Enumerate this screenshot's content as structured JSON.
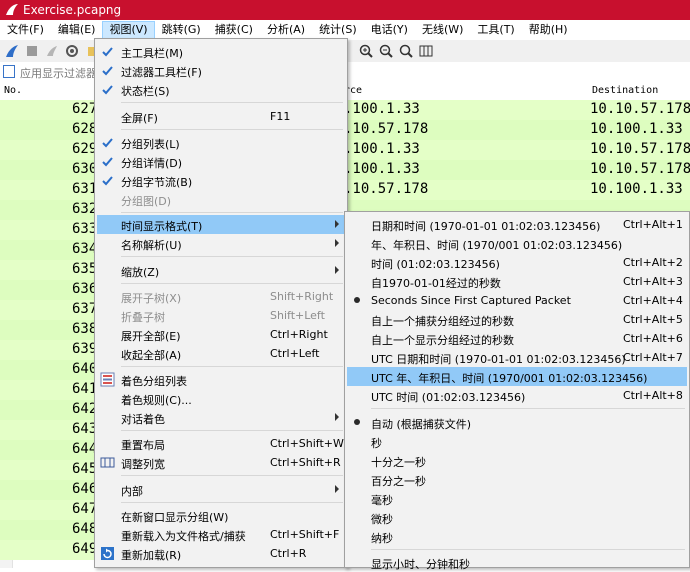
{
  "window": {
    "title": "Exercise.pcapng"
  },
  "menubar": [
    "文件(F)",
    "编辑(E)",
    "视图(V)",
    "跳转(G)",
    "捕获(C)",
    "分析(A)",
    "统计(S)",
    "电话(Y)",
    "无线(W)",
    "工具(T)",
    "帮助(H)"
  ],
  "filter": {
    "placeholder": "应用显示过滤器"
  },
  "columns": {
    "no": "No.",
    "source": "rce",
    "destination": "Destination"
  },
  "packets": [
    {
      "no": "627",
      "src": ".100.1.33",
      "dst": "10.10.57.178"
    },
    {
      "no": "628",
      "src": ".10.57.178",
      "dst": "10.100.1.33"
    },
    {
      "no": "629",
      "src": ".100.1.33",
      "dst": "10.10.57.178"
    },
    {
      "no": "630",
      "src": ".100.1.33",
      "dst": "10.10.57.178"
    },
    {
      "no": "631",
      "src": ".10.57.178",
      "dst": "10.100.1.33"
    },
    {
      "no": "632",
      "src": "",
      "dst": ""
    },
    {
      "no": "633",
      "src": "",
      "dst": ""
    },
    {
      "no": "634",
      "src": "",
      "dst": ""
    },
    {
      "no": "635",
      "src": "",
      "dst": ""
    },
    {
      "no": "636",
      "src": "",
      "dst": ""
    },
    {
      "no": "637",
      "src": "",
      "dst": ""
    },
    {
      "no": "638",
      "src": "",
      "dst": ""
    },
    {
      "no": "639",
      "src": "",
      "dst": ""
    },
    {
      "no": "640",
      "src": "",
      "dst": ""
    },
    {
      "no": "641",
      "src": "",
      "dst": ""
    },
    {
      "no": "642",
      "src": "",
      "dst": ""
    },
    {
      "no": "643",
      "src": "",
      "dst": ""
    },
    {
      "no": "644",
      "src": "",
      "dst": ""
    },
    {
      "no": "645",
      "src": "",
      "dst": ""
    },
    {
      "no": "646",
      "src": "",
      "dst": ""
    },
    {
      "no": "647",
      "src": "",
      "dst": ""
    },
    {
      "no": "648",
      "src": "",
      "dst": ""
    },
    {
      "no": "649",
      "src": "",
      "dst": ""
    }
  ],
  "view_menu": {
    "main_toolbar": "主工具栏(M)",
    "filter_toolbar": "过滤器工具栏(F)",
    "status_bar": "状态栏(S)",
    "fullscreen": "全屏(F)",
    "fullscreen_sc": "F11",
    "packet_list": "分组列表(L)",
    "packet_details": "分组详情(D)",
    "packet_bytes": "分组字节流(B)",
    "packet_diagram": "分组图(D)",
    "time_format": "时间显示格式(T)",
    "name_resolution": "名称解析(U)",
    "zoom": "缩放(Z)",
    "expand_subtrees": "展开子树(X)",
    "expand_subtrees_sc": "Shift+Right",
    "collapse_subtrees": "折叠子树",
    "collapse_subtrees_sc": "Shift+Left",
    "expand_all": "展开全部(E)",
    "expand_all_sc": "Ctrl+Right",
    "collapse_all": "收起全部(A)",
    "collapse_all_sc": "Ctrl+Left",
    "colorize": "着色分组列表",
    "coloring_rules": "着色规则(C)...",
    "conversation_colorize": "对话着色",
    "reset_layout": "重置布局",
    "reset_layout_sc": "Ctrl+Shift+W",
    "resize_columns": "调整列宽",
    "resize_columns_sc": "Ctrl+Shift+R",
    "internals": "内部",
    "new_window": "在新窗口显示分组(W)",
    "reload_format": "重新载入为文件格式/捕获",
    "reload_format_sc": "Ctrl+Shift+F",
    "reload": "重新加载(R)",
    "reload_sc": "Ctrl+R"
  },
  "time_menu": {
    "items": [
      {
        "label": "日期和时间 (1970-01-01 01:02:03.123456)",
        "shortcut": "Ctrl+Alt+1"
      },
      {
        "label": "年、年积日、时间 (1970/001 01:02:03.123456)",
        "shortcut": ""
      },
      {
        "label": "时间 (01:02:03.123456)",
        "shortcut": "Ctrl+Alt+2"
      },
      {
        "label": "自1970-01-01经过的秒数",
        "shortcut": "Ctrl+Alt+3"
      },
      {
        "label": "Seconds Since First Captured Packet",
        "shortcut": "Ctrl+Alt+4"
      },
      {
        "label": "自上一个捕获分组经过的秒数",
        "shortcut": "Ctrl+Alt+5"
      },
      {
        "label": "自上一个显示分组经过的秒数",
        "shortcut": "Ctrl+Alt+6"
      },
      {
        "label": "UTC 日期和时间 (1970-01-01 01:02:03.123456)",
        "shortcut": "Ctrl+Alt+7"
      },
      {
        "label": "UTC 年、年积日、时间 (1970/001 01:02:03.123456)",
        "shortcut": ""
      },
      {
        "label": "UTC 时间 (01:02:03.123456)",
        "shortcut": "Ctrl+Alt+8"
      }
    ],
    "precision": [
      "自动 (根据捕获文件)",
      "秒",
      "十分之一秒",
      "百分之一秒",
      "毫秒",
      "微秒",
      "纳秒"
    ],
    "show_hms": "显示小时、分钟和秒"
  }
}
